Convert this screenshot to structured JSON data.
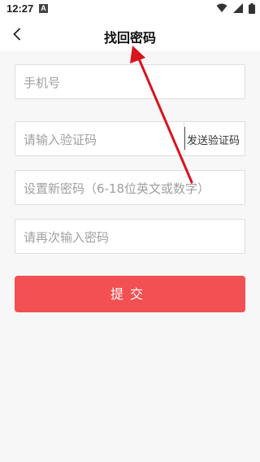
{
  "status_bar": {
    "time": "12:27",
    "notification_icon": "A"
  },
  "header": {
    "title": "找回密码"
  },
  "form": {
    "phone_placeholder": "手机号",
    "code_placeholder": "请输入验证码",
    "send_code_label": "发送验证码",
    "new_password_placeholder": "设置新密码（6-18位英文或数字）",
    "confirm_password_placeholder": "请再次输入密码"
  },
  "submit_label": "提交",
  "colors": {
    "accent": "#f25053",
    "annotation_arrow": "#d9141e"
  }
}
